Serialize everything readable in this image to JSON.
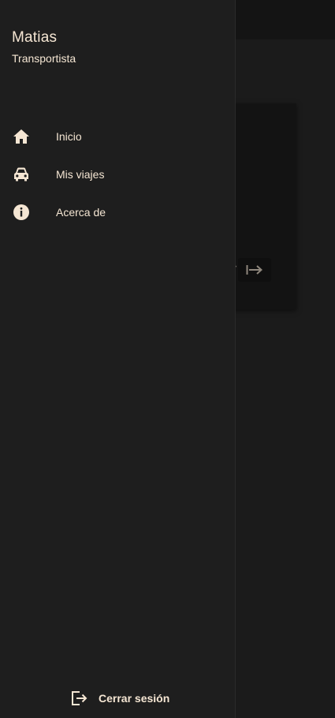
{
  "colors": {
    "text": "#f5e6d3",
    "drawer_bg": "#1e1e1e",
    "background": "#1b1b1b"
  },
  "drawer": {
    "user": {
      "name": "Matias",
      "role": "Transportista"
    },
    "items": [
      {
        "label": "Inicio",
        "icon": "home-icon"
      },
      {
        "label": "Mis viajes",
        "icon": "car-icon"
      },
      {
        "label": "Acerca de",
        "icon": "info-icon"
      }
    ],
    "logout": {
      "label": "Cerrar sesión",
      "icon": "logout-icon"
    }
  },
  "background_card": {
    "button_icon": "arrow-right-to-bar-icon"
  }
}
